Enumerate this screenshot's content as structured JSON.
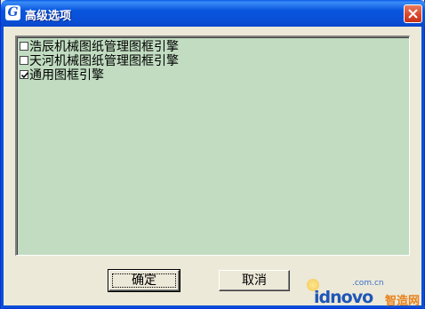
{
  "window": {
    "title": "高级选项",
    "app_icon": "G"
  },
  "options": [
    {
      "label": "浩辰机械图纸管理图框引擎",
      "checked": false
    },
    {
      "label": "天河机械图纸管理图框引擎",
      "checked": false
    },
    {
      "label": "通用图框引擎",
      "checked": true
    }
  ],
  "buttons": {
    "ok_label": "确定",
    "cancel_label": "取消"
  },
  "watermark": {
    "domain_suffix": ".com.cn",
    "brand": "idnovo",
    "brand_cn": "智造网"
  },
  "colors": {
    "titlebar": "#0a4fd6",
    "list_background": "#c1dcc1",
    "dialog_background": "#ece9d8",
    "close_button": "#d9442a"
  }
}
